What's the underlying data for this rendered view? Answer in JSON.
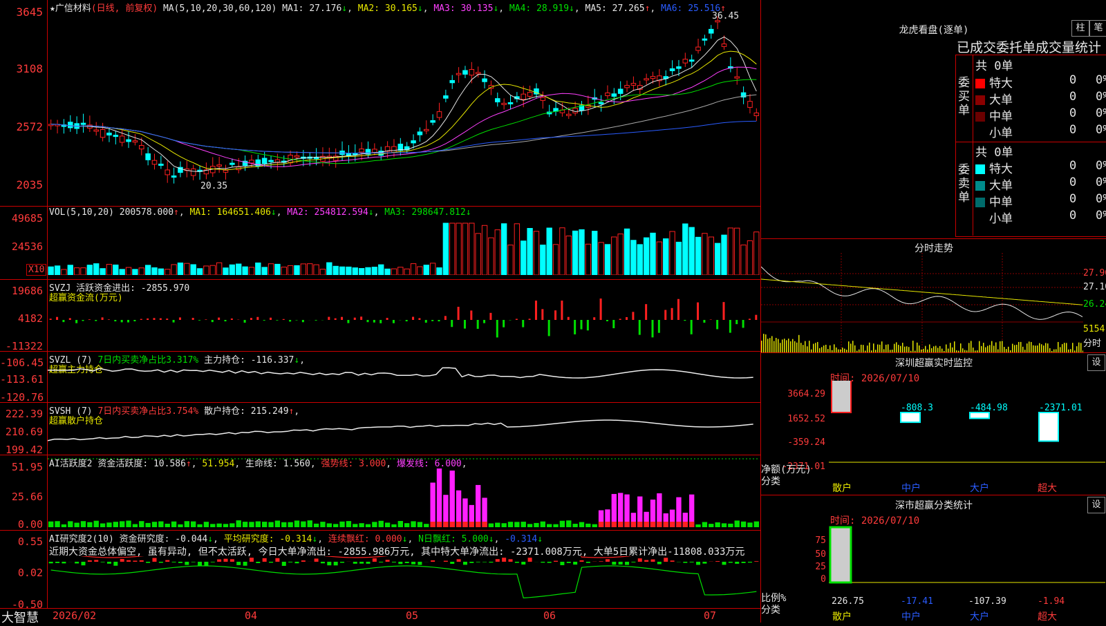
{
  "main": {
    "stock_name": "广信材料",
    "mode": "(日线, 前复权)",
    "ma_header": "MA(5,10,20,30,60,120)",
    "ma1": "MA1: 27.176",
    "ma2": "MA2: 30.165",
    "ma3": "MA3: 30.135",
    "ma4": "MA4: 28.919",
    "ma5": "MA5: 27.265",
    "ma6": "MA6: 25.516",
    "high_label": "36.45",
    "low_label": "20.35",
    "y_ticks": [
      "3645",
      "3108",
      "2572",
      "2035"
    ]
  },
  "vol": {
    "header": "VOL(5,10,20)",
    "val": "200578.000",
    "ma1": "MA1: 164651.406",
    "ma2": "MA2: 254812.594",
    "ma3": "MA3: 298647.812",
    "y_ticks": [
      "49685",
      "24536"
    ],
    "unit": "X10"
  },
  "svzj": {
    "line1": "SVZJ   活跃资金进出: -2855.970",
    "line2": "超赢资金流(万元)",
    "y_ticks": [
      "19686",
      "4182",
      "-11322"
    ]
  },
  "svzl": {
    "name": "SVZL  (7)",
    "ratio": "7日内买卖净占比3.317%",
    "holding": "主力持仓: -116.337",
    "line2": "超赢主力持仓",
    "y_ticks": [
      "-106.45",
      "-113.61",
      "-120.76"
    ]
  },
  "svsh": {
    "name": "SVSH  (7)",
    "ratio": "7日内买卖净占比3.754%",
    "holding": "散户持仓: 215.249",
    "line2": "超赢散户持仓",
    "y_ticks": [
      "222.39",
      "210.69",
      "199.42"
    ]
  },
  "ai1": {
    "name": "AI活跃度2",
    "a": "资金活跃度: 10.586",
    "b": "51.954",
    "c": "生命线: 1.560",
    "d": "强势线: 3.000",
    "e": "爆发线: 6.000",
    "y_ticks": [
      "51.95",
      "25.66",
      "0.00"
    ]
  },
  "ai2": {
    "name": "AI研究度2(10)",
    "a": "资金研究度: -0.044",
    "b": "平均研究度: -0.314",
    "c": "连续飘红: 0.000",
    "d": "N日飘红: 5.000",
    "e": "-0.314",
    "desc": "近期大资金总体偏空, 虽有异动, 但不太活跃, 今日大单净流出: -2855.986万元, 其中特大单净流出: -2371.008万元, 大单5日累计净出-11808.033万元",
    "y_ticks": [
      "0.55",
      "0.02",
      "-0.50"
    ]
  },
  "xaxis": {
    "labels": [
      "2026/02",
      "04",
      "05",
      "06",
      "07"
    ],
    "brand": "大智慧"
  },
  "lhb": {
    "title": "龙虎看盘(逐单)",
    "btn1": "柱",
    "btn2": "笔",
    "subtitle": "已成交委托单成交量统计",
    "buy_label": "委买单",
    "sell_label": "委卖单",
    "buy_total": "共 0单",
    "sell_total": "共 0单",
    "buy_rows": [
      {
        "name": "特大",
        "count": "0",
        "pct": "0%"
      },
      {
        "name": "大单",
        "count": "0",
        "pct": "0%"
      },
      {
        "name": "中单",
        "count": "0",
        "pct": "0%"
      },
      {
        "name": "小单",
        "count": "0",
        "pct": "0%"
      }
    ],
    "sell_rows": [
      {
        "name": "特大",
        "count": "0",
        "pct": "0%"
      },
      {
        "name": "大单",
        "count": "0",
        "pct": "0%"
      },
      {
        "name": "中单",
        "count": "0",
        "pct": "0%"
      },
      {
        "name": "小单",
        "count": "0",
        "pct": "0%"
      }
    ]
  },
  "fenshi": {
    "title": "分时走势",
    "ticks": [
      "27.96",
      "27.10",
      "26.24"
    ],
    "vol_label": "5154",
    "vol_unit": "分时"
  },
  "monitor": {
    "title": "深圳超赢实时监控",
    "btn": "设",
    "time": "时间: 2026/07/10",
    "y_ticks": [
      "3664.29",
      "1652.52",
      "-359.24",
      "-2371.01"
    ],
    "bar_labels": [
      "3664.29",
      "-808.3",
      "-484.98",
      "-2371.01"
    ],
    "ylab1": "净额(万元)",
    "ylab2": "分类",
    "categories": [
      "散户",
      "中户",
      "大户",
      "超大"
    ]
  },
  "classify": {
    "title": "深市超赢分类统计",
    "btn": "设",
    "time": "时间: 2026/07/10",
    "y_ticks": [
      "75",
      "50",
      "25",
      "0"
    ],
    "values": [
      "226.75",
      "-17.41",
      "-107.39",
      "-1.94"
    ],
    "ylab1": "比例%",
    "ylab2": "分类",
    "categories": [
      "散户",
      "中户",
      "大户",
      "超大"
    ]
  }
}
